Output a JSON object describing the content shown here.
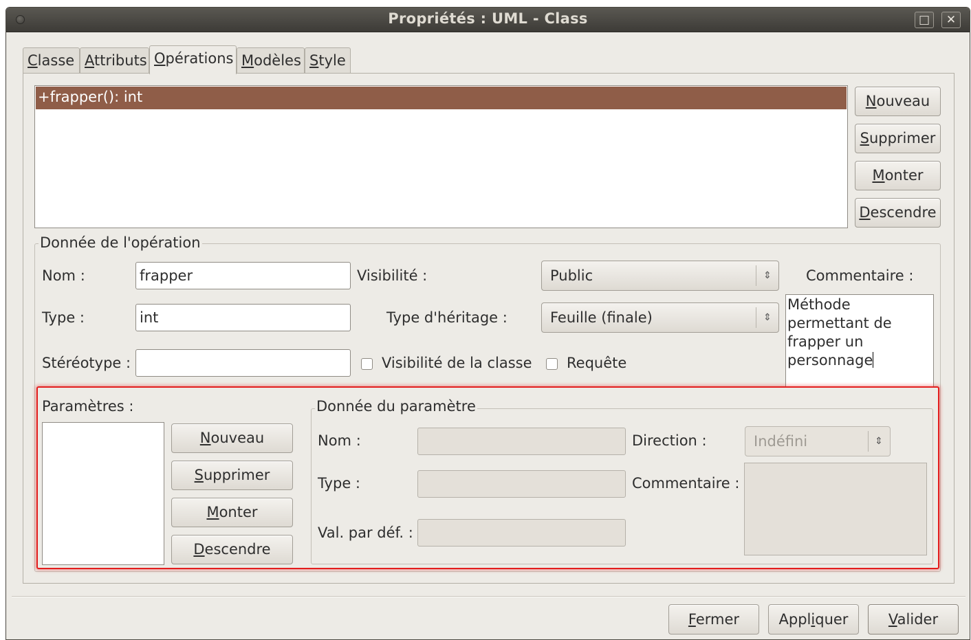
{
  "window": {
    "title": "Propriétés : UML - Class",
    "maximize_glyph": "□",
    "close_glyph": "✕"
  },
  "tabs": [
    {
      "label": "Classe",
      "mnemonic": "C",
      "rest": "lasse"
    },
    {
      "label": "Attributs",
      "mnemonic": "A",
      "rest": "ttributs"
    },
    {
      "label": "Opérations",
      "mnemonic": "O",
      "rest": "pérations",
      "active": true
    },
    {
      "label": "Modèles",
      "mnemonic": "M",
      "rest": "odèles"
    },
    {
      "label": "Style",
      "mnemonic": "S",
      "rest": "tyle"
    }
  ],
  "operations": {
    "items": [
      "+frapper(): int"
    ],
    "selected_index": 0,
    "selection_color": "#8f5d48",
    "buttons": {
      "new": {
        "mnemonic": "N",
        "rest": "ouveau"
      },
      "delete": {
        "mnemonic": "S",
        "rest": "upprimer"
      },
      "up": {
        "mnemonic": "M",
        "rest": "onter"
      },
      "down": {
        "mnemonic": "D",
        "rest": "escendre"
      }
    }
  },
  "operation_data": {
    "frame_label": "Donnée de l'opération",
    "name_label": "Nom :",
    "name_value": "frapper",
    "type_label": "Type :",
    "type_value": "int",
    "stereotype_label": "Stéréotype :",
    "stereotype_value": "",
    "visibility_label": "Visibilité :",
    "visibility_value": "Public",
    "inheritance_label": "Type d'héritage :",
    "inheritance_value": "Feuille (finale)",
    "class_scope_label": "Visibilité de la classe",
    "class_scope_checked": false,
    "query_label": "Requête",
    "query_checked": false,
    "comment_label": "Commentaire :",
    "comment_lines": [
      "Méthode",
      "permettant de",
      "frapper un",
      "personnage"
    ]
  },
  "parameters": {
    "label": "Paramètres :",
    "items": [],
    "buttons": {
      "new": {
        "mnemonic": "N",
        "rest": "ouveau"
      },
      "delete": {
        "mnemonic": "S",
        "rest": "upprimer"
      },
      "up": {
        "mnemonic": "M",
        "rest": "onter"
      },
      "down": {
        "mnemonic": "D",
        "rest": "escendre"
      }
    },
    "highlight_color": "#e31d1d"
  },
  "parameter_data": {
    "frame_label": "Donnée du paramètre",
    "name_label": "Nom :",
    "name_value": "",
    "type_label": "Type :",
    "type_value": "",
    "default_label": "Val. par déf. :",
    "default_value": "",
    "direction_label": "Direction :",
    "direction_value": "Indéfini",
    "comment_label": "Commentaire :",
    "comment_value": "",
    "enabled": false
  },
  "footer": {
    "close": {
      "mnemonic": "F",
      "rest": "ermer"
    },
    "apply": {
      "before": "Appl",
      "mnemonic": "i",
      "rest": "quer"
    },
    "ok": {
      "mnemonic": "V",
      "rest": "alider"
    }
  }
}
